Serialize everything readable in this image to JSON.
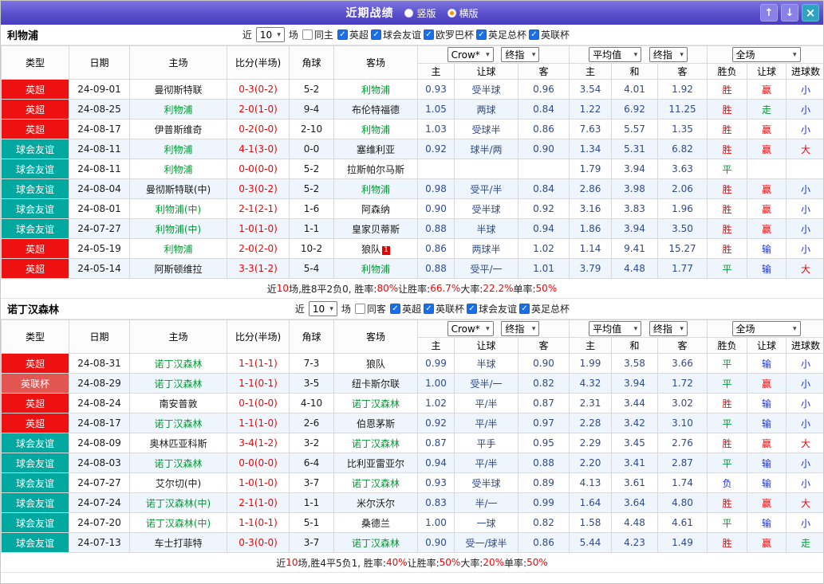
{
  "titlebar": {
    "title": "近期战绩",
    "radios": [
      {
        "label": "竖版",
        "selected": false
      },
      {
        "label": "横版",
        "selected": true
      }
    ],
    "buttons": {
      "up": "↑",
      "down": "↓",
      "close": "×"
    }
  },
  "icons": {
    "chevron": "▾",
    "check": "✓"
  },
  "league_colors": {
    "英超": "#ee1111",
    "球会友谊": "#00a8a0",
    "英联杯": "#e25550"
  },
  "result_colors": {
    "red": "#f00505",
    "green": "#009933",
    "blue": "#2033cc"
  },
  "table_header": {
    "cols": [
      "类型",
      "日期",
      "主场",
      "比分(半场)",
      "角球",
      "客场"
    ],
    "bookmaker": "Crow*",
    "final": "终指",
    "average": "平均值",
    "scope": "全场",
    "sub": [
      "主",
      "让球",
      "客",
      "主",
      "和",
      "客",
      "胜负",
      "让球",
      "进球数"
    ]
  },
  "sections": [
    {
      "team": "利物浦",
      "filter": {
        "near_label": "近",
        "count": "10",
        "games_label": "场",
        "same_label": "同主",
        "same_checked": false,
        "competitions": [
          {
            "label": "英超",
            "checked": true
          },
          {
            "label": "球会友谊",
            "checked": true
          },
          {
            "label": "欧罗巴杯",
            "checked": true
          },
          {
            "label": "英足总杯",
            "checked": true
          },
          {
            "label": "英联杯",
            "checked": true
          }
        ]
      },
      "rows": [
        {
          "league": "英超",
          "date": "24-09-01",
          "home": {
            "name": "曼彻斯特联"
          },
          "score": "0-3(0-2)",
          "corners": "5-2",
          "away": {
            "name": "利物浦",
            "green": true
          },
          "asian": [
            "0.93",
            "受半球",
            "0.96"
          ],
          "euro": [
            "3.54",
            "4.01",
            "1.92"
          ],
          "results": [
            [
              "胜",
              "red"
            ],
            [
              "赢",
              "red"
            ],
            [
              "小",
              "blue"
            ]
          ]
        },
        {
          "league": "英超",
          "date": "24-08-25",
          "home": {
            "name": "利物浦",
            "green": true
          },
          "score": "2-0(1-0)",
          "corners": "9-4",
          "away": {
            "name": "布伦特福德"
          },
          "asian": [
            "1.05",
            "两球",
            "0.84"
          ],
          "euro": [
            "1.22",
            "6.92",
            "11.25"
          ],
          "results": [
            [
              "胜",
              "red"
            ],
            [
              "走",
              "green"
            ],
            [
              "小",
              "blue"
            ]
          ]
        },
        {
          "league": "英超",
          "date": "24-08-17",
          "home": {
            "name": "伊普斯维奇"
          },
          "score": "0-2(0-0)",
          "corners": "2-10",
          "away": {
            "name": "利物浦",
            "green": true
          },
          "asian": [
            "1.03",
            "受球半",
            "0.86"
          ],
          "euro": [
            "7.63",
            "5.57",
            "1.35"
          ],
          "results": [
            [
              "胜",
              "red"
            ],
            [
              "赢",
              "red"
            ],
            [
              "小",
              "blue"
            ]
          ]
        },
        {
          "league": "球会友谊",
          "date": "24-08-11",
          "home": {
            "name": "利物浦",
            "green": true
          },
          "score": "4-1(3-0)",
          "corners": "0-0",
          "away": {
            "name": "塞维利亚"
          },
          "asian": [
            "0.92",
            "球半/两",
            "0.90"
          ],
          "euro": [
            "1.34",
            "5.31",
            "6.82"
          ],
          "results": [
            [
              "胜",
              "red"
            ],
            [
              "赢",
              "red"
            ],
            [
              "大",
              "red"
            ]
          ]
        },
        {
          "league": "球会友谊",
          "date": "24-08-11",
          "home": {
            "name": "利物浦",
            "green": true
          },
          "score": "0-0(0-0)",
          "corners": "5-2",
          "away": {
            "name": "拉斯帕尔马斯"
          },
          "asian": [
            "",
            "",
            ""
          ],
          "euro": [
            "1.79",
            "3.94",
            "3.63"
          ],
          "results": [
            [
              "平",
              "green"
            ],
            [
              "",
              ""
            ],
            [
              "",
              ""
            ]
          ]
        },
        {
          "league": "球会友谊",
          "date": "24-08-04",
          "home": {
            "name": "曼彻斯特联(中)"
          },
          "score": "0-3(0-2)",
          "corners": "5-2",
          "away": {
            "name": "利物浦",
            "green": true
          },
          "asian": [
            "0.98",
            "受平/半",
            "0.84"
          ],
          "euro": [
            "2.86",
            "3.98",
            "2.06"
          ],
          "results": [
            [
              "胜",
              "red"
            ],
            [
              "赢",
              "red"
            ],
            [
              "小",
              "blue"
            ]
          ]
        },
        {
          "league": "球会友谊",
          "date": "24-08-01",
          "home": {
            "name": "利物浦(中)",
            "green": true
          },
          "score": "2-1(2-1)",
          "corners": "1-6",
          "away": {
            "name": "阿森纳"
          },
          "asian": [
            "0.90",
            "受半球",
            "0.92"
          ],
          "euro": [
            "3.16",
            "3.83",
            "1.96"
          ],
          "results": [
            [
              "胜",
              "red"
            ],
            [
              "赢",
              "red"
            ],
            [
              "小",
              "blue"
            ]
          ]
        },
        {
          "league": "球会友谊",
          "date": "24-07-27",
          "home": {
            "name": "利物浦(中)",
            "green": true
          },
          "score": "1-0(1-0)",
          "corners": "1-1",
          "away": {
            "name": "皇家贝蒂斯"
          },
          "asian": [
            "0.88",
            "半球",
            "0.94"
          ],
          "euro": [
            "1.86",
            "3.94",
            "3.50"
          ],
          "results": [
            [
              "胜",
              "red"
            ],
            [
              "赢",
              "red"
            ],
            [
              "小",
              "blue"
            ]
          ]
        },
        {
          "league": "英超",
          "date": "24-05-19",
          "home": {
            "name": "利物浦",
            "green": true
          },
          "score": "2-0(2-0)",
          "corners": "10-2",
          "away": {
            "name": "狼队",
            "rc": "1"
          },
          "asian": [
            "0.86",
            "两球半",
            "1.02"
          ],
          "euro": [
            "1.14",
            "9.41",
            "15.27"
          ],
          "results": [
            [
              "胜",
              "red"
            ],
            [
              "输",
              "blue"
            ],
            [
              "小",
              "blue"
            ]
          ]
        },
        {
          "league": "英超",
          "date": "24-05-14",
          "home": {
            "name": "阿斯顿维拉"
          },
          "score": "3-3(1-2)",
          "corners": "5-4",
          "away": {
            "name": "利物浦",
            "green": true
          },
          "asian": [
            "0.88",
            "受平/一",
            "1.01"
          ],
          "euro": [
            "3.79",
            "4.48",
            "1.77"
          ],
          "results": [
            [
              "平",
              "green"
            ],
            [
              "输",
              "blue"
            ],
            [
              "大",
              "red"
            ]
          ]
        }
      ],
      "summary": [
        {
          "t": "近"
        },
        {
          "t": "10",
          "r": true
        },
        {
          "t": "场,胜8平2负0, 胜率:"
        },
        {
          "t": "80%",
          "r": true
        },
        {
          "t": " 让胜率:"
        },
        {
          "t": "66.7%",
          "r": true
        },
        {
          "t": " 大率:"
        },
        {
          "t": "22.2%",
          "r": true
        },
        {
          "t": " 单率:"
        },
        {
          "t": "50%",
          "r": true
        }
      ]
    },
    {
      "team": "诺丁汉森林",
      "filter": {
        "near_label": "近",
        "count": "10",
        "games_label": "场",
        "same_label": "同客",
        "same_checked": false,
        "competitions": [
          {
            "label": "英超",
            "checked": true
          },
          {
            "label": "英联杯",
            "checked": true
          },
          {
            "label": "球会友谊",
            "checked": true
          },
          {
            "label": "英足总杯",
            "checked": true
          }
        ]
      },
      "rows": [
        {
          "league": "英超",
          "date": "24-08-31",
          "home": {
            "name": "诺丁汉森林",
            "green": true
          },
          "score": "1-1(1-1)",
          "corners": "7-3",
          "away": {
            "name": "狼队"
          },
          "asian": [
            "0.99",
            "半球",
            "0.90"
          ],
          "euro": [
            "1.99",
            "3.58",
            "3.66"
          ],
          "results": [
            [
              "平",
              "green"
            ],
            [
              "输",
              "blue"
            ],
            [
              "小",
              "blue"
            ]
          ]
        },
        {
          "league": "英联杯",
          "date": "24-08-29",
          "home": {
            "name": "诺丁汉森林",
            "green": true
          },
          "score": "1-1(0-1)",
          "corners": "3-5",
          "away": {
            "name": "纽卡斯尔联"
          },
          "asian": [
            "1.00",
            "受半/一",
            "0.82"
          ],
          "euro": [
            "4.32",
            "3.94",
            "1.72"
          ],
          "results": [
            [
              "平",
              "green"
            ],
            [
              "赢",
              "red"
            ],
            [
              "小",
              "blue"
            ]
          ]
        },
        {
          "league": "英超",
          "date": "24-08-24",
          "home": {
            "name": "南安普敦"
          },
          "score": "0-1(0-0)",
          "corners": "4-10",
          "away": {
            "name": "诺丁汉森林",
            "green": true
          },
          "asian": [
            "1.02",
            "平/半",
            "0.87"
          ],
          "euro": [
            "2.31",
            "3.44",
            "3.02"
          ],
          "results": [
            [
              "胜",
              "red"
            ],
            [
              "输",
              "blue"
            ],
            [
              "小",
              "blue"
            ]
          ]
        },
        {
          "league": "英超",
          "date": "24-08-17",
          "home": {
            "name": "诺丁汉森林",
            "green": true
          },
          "score": "1-1(1-0)",
          "corners": "2-6",
          "away": {
            "name": "伯恩茅斯"
          },
          "asian": [
            "0.92",
            "平/半",
            "0.97"
          ],
          "euro": [
            "2.28",
            "3.42",
            "3.10"
          ],
          "results": [
            [
              "平",
              "green"
            ],
            [
              "输",
              "blue"
            ],
            [
              "小",
              "blue"
            ]
          ]
        },
        {
          "league": "球会友谊",
          "date": "24-08-09",
          "home": {
            "name": "奥林匹亚科斯"
          },
          "score": "3-4(1-2)",
          "corners": "3-2",
          "away": {
            "name": "诺丁汉森林",
            "green": true
          },
          "asian": [
            "0.87",
            "平手",
            "0.95"
          ],
          "euro": [
            "2.29",
            "3.45",
            "2.76"
          ],
          "results": [
            [
              "胜",
              "red"
            ],
            [
              "赢",
              "red"
            ],
            [
              "大",
              "red"
            ]
          ]
        },
        {
          "league": "球会友谊",
          "date": "24-08-03",
          "home": {
            "name": "诺丁汉森林",
            "green": true
          },
          "score": "0-0(0-0)",
          "corners": "6-4",
          "away": {
            "name": "比利亚雷亚尔"
          },
          "asian": [
            "0.94",
            "平/半",
            "0.88"
          ],
          "euro": [
            "2.20",
            "3.41",
            "2.87"
          ],
          "results": [
            [
              "平",
              "green"
            ],
            [
              "输",
              "blue"
            ],
            [
              "小",
              "blue"
            ]
          ]
        },
        {
          "league": "球会友谊",
          "date": "24-07-27",
          "home": {
            "name": "艾尔切(中)"
          },
          "score": "1-0(1-0)",
          "corners": "3-7",
          "away": {
            "name": "诺丁汉森林",
            "green": true
          },
          "asian": [
            "0.93",
            "受半球",
            "0.89"
          ],
          "euro": [
            "4.13",
            "3.61",
            "1.74"
          ],
          "results": [
            [
              "负",
              "blue"
            ],
            [
              "输",
              "blue"
            ],
            [
              "小",
              "blue"
            ]
          ]
        },
        {
          "league": "球会友谊",
          "date": "24-07-24",
          "home": {
            "name": "诺丁汉森林(中)",
            "green": true
          },
          "score": "2-1(1-0)",
          "corners": "1-1",
          "away": {
            "name": "米尔沃尔"
          },
          "asian": [
            "0.83",
            "半/一",
            "0.99"
          ],
          "euro": [
            "1.64",
            "3.64",
            "4.80"
          ],
          "results": [
            [
              "胜",
              "red"
            ],
            [
              "赢",
              "red"
            ],
            [
              "大",
              "red"
            ]
          ]
        },
        {
          "league": "球会友谊",
          "date": "24-07-20",
          "home": {
            "name": "诺丁汉森林(中)",
            "green": true
          },
          "score": "1-1(0-1)",
          "corners": "5-1",
          "away": {
            "name": "桑德兰"
          },
          "asian": [
            "1.00",
            "一球",
            "0.82"
          ],
          "euro": [
            "1.58",
            "4.48",
            "4.61"
          ],
          "results": [
            [
              "平",
              "green"
            ],
            [
              "输",
              "blue"
            ],
            [
              "小",
              "blue"
            ]
          ]
        },
        {
          "league": "球会友谊",
          "date": "24-07-13",
          "home": {
            "name": "车士打菲特"
          },
          "score": "0-3(0-0)",
          "corners": "3-7",
          "away": {
            "name": "诺丁汉森林",
            "green": true
          },
          "asian": [
            "0.90",
            "受一/球半",
            "0.86"
          ],
          "euro": [
            "5.44",
            "4.23",
            "1.49"
          ],
          "results": [
            [
              "胜",
              "red"
            ],
            [
              "赢",
              "red"
            ],
            [
              "走",
              "green"
            ]
          ]
        }
      ],
      "summary": [
        {
          "t": "近"
        },
        {
          "t": "10",
          "r": true
        },
        {
          "t": "场,胜4平5负1, 胜率:"
        },
        {
          "t": "40%",
          "r": true
        },
        {
          "t": " 让胜率:"
        },
        {
          "t": "50%",
          "r": true
        },
        {
          "t": " 大率:"
        },
        {
          "t": "20%",
          "r": true
        },
        {
          "t": " 单率:"
        },
        {
          "t": "50%",
          "r": true
        }
      ]
    }
  ]
}
